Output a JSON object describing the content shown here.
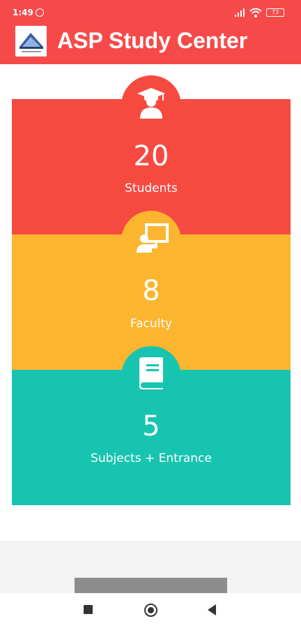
{
  "status_bar": {
    "time": "1:49",
    "battery": "73"
  },
  "app_bar": {
    "title": "ASP Study Center",
    "logo_icon": "study-center-logo"
  },
  "stats": [
    {
      "count": "20",
      "label": "Students",
      "icon": "graduate-icon",
      "color": "#f64a41"
    },
    {
      "count": "8",
      "label": "Faculty",
      "icon": "teacher-board-icon",
      "color": "#fbb52f"
    },
    {
      "count": "5",
      "label": "Subjects + Entrance",
      "icon": "book-icon",
      "color": "#17c4b0"
    }
  ],
  "colors": {
    "app_bar": "#f64a4a"
  },
  "nav_bar": {
    "recent_icon": "square-icon",
    "home_icon": "circle-icon",
    "back_icon": "triangle-back-icon"
  }
}
